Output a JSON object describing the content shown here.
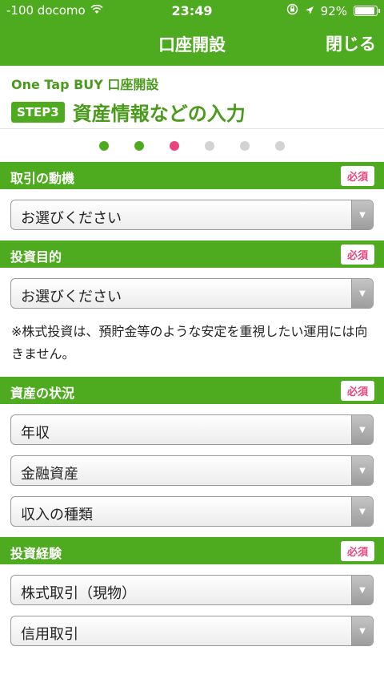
{
  "status": {
    "carrier": "-100 docomo",
    "time": "23:49",
    "battery": "92%",
    "battery_level": 0.92
  },
  "nav": {
    "title": "口座開設",
    "close": "閉じる"
  },
  "header": {
    "subtitle": "One Tap BUY 口座開設",
    "step_badge": "STEP3",
    "step_title": "資産情報などの入力"
  },
  "progress": {
    "total_steps": 6,
    "current_step": 3
  },
  "required_label": "必須",
  "sections": {
    "motive": {
      "label": "取引の動機",
      "selects": [
        "お選びください"
      ]
    },
    "purpose": {
      "label": "投資目的",
      "selects": [
        "お選びください"
      ],
      "note": "※株式投資は、預貯金等のような安定を重視したい運用には向きません。"
    },
    "assets": {
      "label": "資産の状況",
      "selects": [
        "年収",
        "金融資産",
        "収入の種類"
      ]
    },
    "experience": {
      "label": "投資経験",
      "selects": [
        "株式取引（現物）",
        "信用取引"
      ]
    }
  },
  "colors": {
    "brand_green": "#4eaa1e",
    "required_pink": "#e8457e",
    "inactive_dot": "#d3d3d3"
  },
  "icons": [
    "wifi-icon",
    "lock-rotation-icon",
    "location-arrow-icon",
    "battery-icon",
    "dropdown-arrow-icon"
  ]
}
